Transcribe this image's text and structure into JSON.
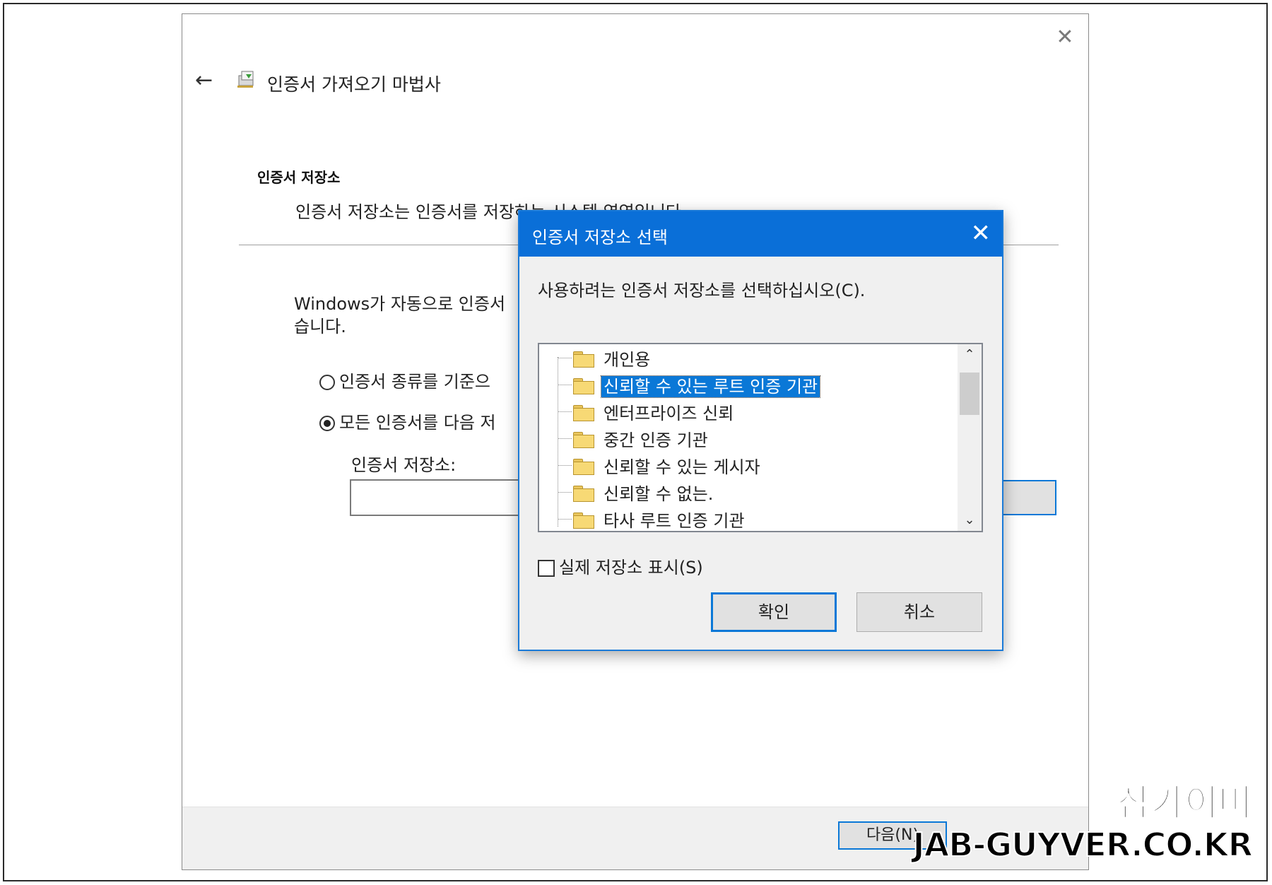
{
  "wizard": {
    "title": "인증서 가져오기 마법사",
    "close_glyph": "✕",
    "back_glyph": "←",
    "section_title": "인증서 저장소",
    "section_desc": "인증서 저장소는 인증서를 저장하는 시스템 영역입니다.",
    "auto_text_line1": "Windows가 자동으로 인증서",
    "auto_text_line2": "습니다.",
    "radio_auto_label": "인증서 종류를 기준으",
    "radio_all_label": "모든 인증서를 다음 저",
    "store_label": "인증서 저장소:",
    "store_value": "",
    "next_label": "다음(N)"
  },
  "dialog": {
    "title": "인증서 저장소 선택",
    "close_glyph": "✕",
    "prompt": "사용하려는 인증서 저장소를 선택하십시오(C).",
    "stores": [
      {
        "label": "개인용",
        "selected": false
      },
      {
        "label": "신뢰할 수 있는 루트 인증 기관",
        "selected": true
      },
      {
        "label": "엔터프라이즈 신뢰",
        "selected": false
      },
      {
        "label": "중간 인증 기관",
        "selected": false
      },
      {
        "label": "신뢰할 수 있는 게시자",
        "selected": false
      },
      {
        "label": "신뢰할 수 없는.",
        "selected": false
      },
      {
        "label": "타사 루트 인증 기관",
        "selected": false
      }
    ],
    "scroll_up_glyph": "⌃",
    "scroll_down_glyph": "⌄",
    "show_physical_label": "실제 저장소 표시(S)",
    "show_physical_checked": false,
    "ok_label": "확인",
    "cancel_label": "취소"
  },
  "watermark": {
    "line1": "잡가이버",
    "line2": "JAB-GUYVER.CO.KR"
  }
}
